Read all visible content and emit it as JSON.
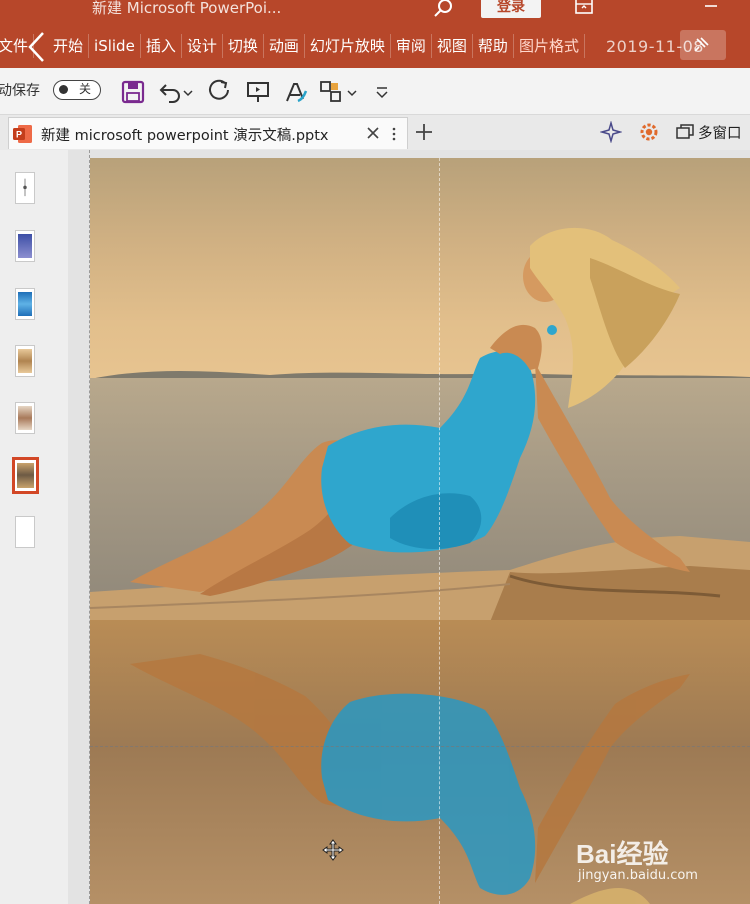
{
  "titlebar": {
    "title": "新建 Microsoft PowerPoi...",
    "login_label": "登录"
  },
  "menu": {
    "tabs": [
      "文件",
      "开始",
      "iSlide",
      "插入",
      "设计",
      "切换",
      "动画",
      "幻灯片放映",
      "审阅",
      "视图",
      "帮助",
      "图片格式"
    ],
    "date": "2019-11-08"
  },
  "qat": {
    "autosave_label": "动保存",
    "autosave_state": "关"
  },
  "document": {
    "tab_name": "新建 microsoft powerpoint 演示文稿.pptx",
    "multiwindow_label": "多窗口"
  },
  "thumbnails": {
    "count": 7,
    "selected_index": 6
  },
  "watermark": {
    "brand": "Bai经验",
    "url": "jingyan.baidu.com"
  },
  "colors": {
    "accent": "#b7472a",
    "selection": "#d24726",
    "dress": "#2aa3c9"
  }
}
